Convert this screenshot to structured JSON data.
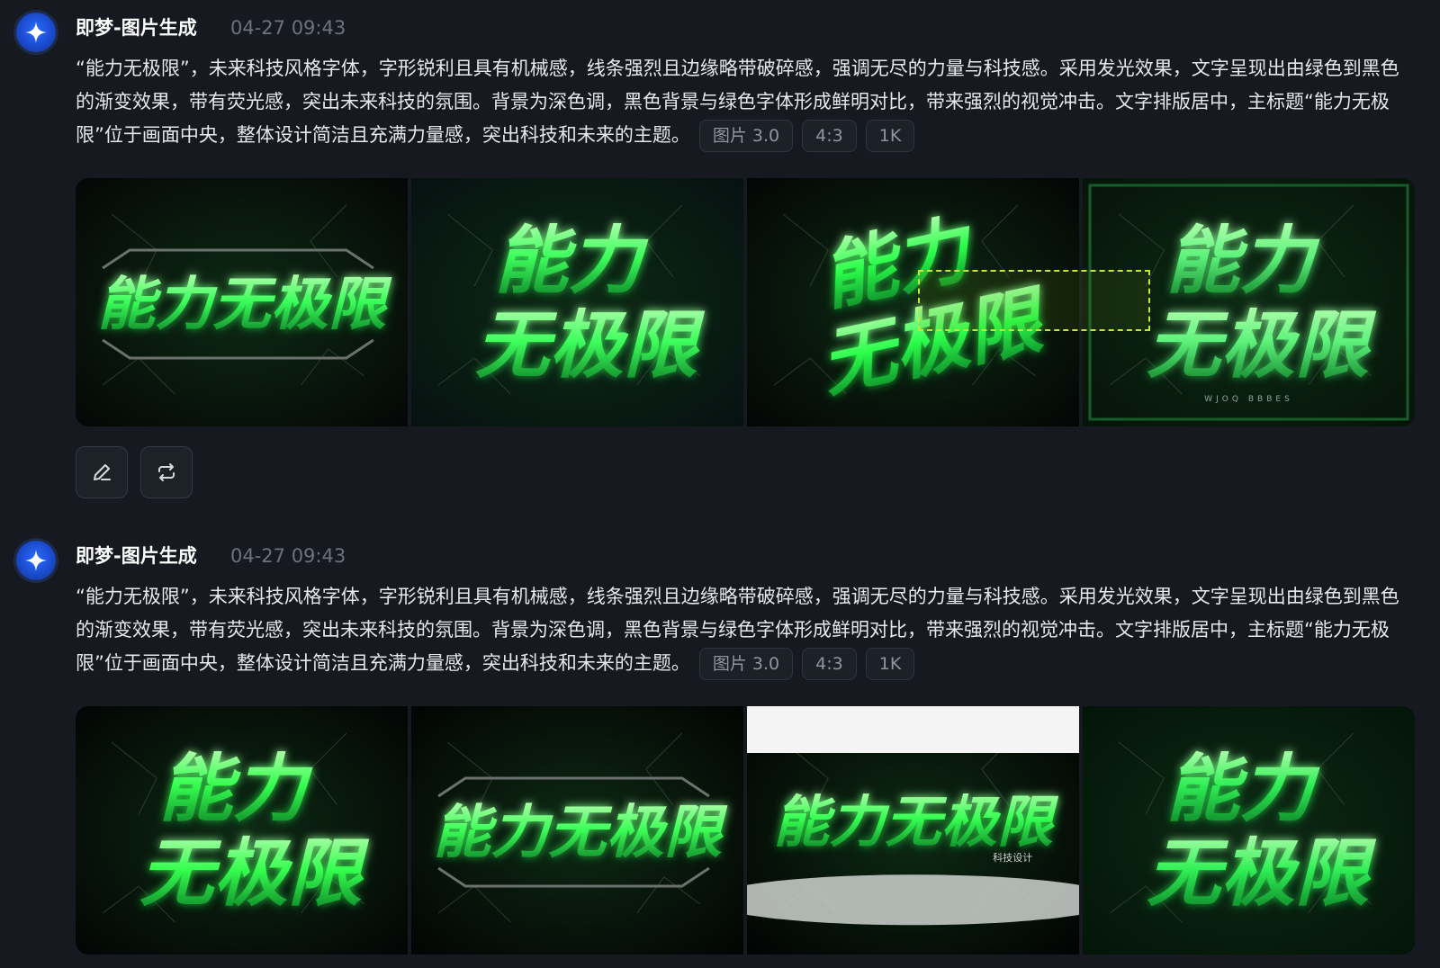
{
  "messages": [
    {
      "sender": "即梦-图片生成",
      "time": "04-27  09:43",
      "prompt": "“能力无极限”，未来科技风格字体，字形锐利且具有机械感，线条强烈且边缘略带破碎感，强调无尽的力量与科技感。采用发光效果，文字呈现出由绿色到黑色的渐变效果，带有荧光感，突出未来科技的氛围。背景为深色调，黑色背景与绿色字体形成鲜明对比，带来强烈的视觉冲击。文字排版居中，主标题“能力无极限”位于画面中央，整体设计简洁且充满力量感，突出科技和未来的主题。",
      "tags": [
        "图片 3.0",
        "4:3",
        "1K"
      ],
      "images": [
        {
          "text": "能力无极限",
          "layout": "single",
          "color": "#39ff5a",
          "bg": "#050706",
          "subtext": ""
        },
        {
          "text": "能力无极限",
          "layout": "double",
          "color": "#3dff5c",
          "bg": "#061211",
          "subtext": ""
        },
        {
          "text": "能力无极限",
          "layout": "double-tilt",
          "color": "#2cff4b",
          "bg": "#040605",
          "subtext": ""
        },
        {
          "text": "能力无极限",
          "layout": "double-outline",
          "color": "#5cf27a",
          "bg": "#061409",
          "subtext": "WJOQ  BBBES"
        }
      ],
      "actions": {
        "edit_icon": "pencil-icon",
        "regenerate_icon": "repeat-icon"
      }
    },
    {
      "sender": "即梦-图片生成",
      "time": "04-27  09:43",
      "prompt": "“能力无极限”，未来科技风格字体，字形锐利且具有机械感，线条强烈且边缘略带破碎感，强调无尽的力量与科技感。采用发光效果，文字呈现出由绿色到黑色的渐变效果，带有荧光感，突出未来科技的氛围。背景为深色调，黑色背景与绿色字体形成鲜明对比，带来强烈的视觉冲击。文字排版居中，主标题“能力无极限”位于画面中央，整体设计简洁且充满力量感，突出科技和未来的主题。",
      "tags": [
        "图片 3.0",
        "4:3",
        "1K"
      ],
      "images": [
        {
          "text": "能力无极限",
          "layout": "double",
          "color": "#35ff4f",
          "bg": "#030504",
          "subtext": ""
        },
        {
          "text": "能力无极限",
          "layout": "single",
          "color": "#3cff58",
          "bg": "#030403",
          "subtext": ""
        },
        {
          "text": "能力无极限",
          "layout": "single-white-band",
          "color": "#36ff52",
          "bg": "#020302",
          "subtext": "科技设计"
        },
        {
          "text": "能力无极限",
          "layout": "double",
          "color": "#30ef55",
          "bg": "#041409",
          "subtext": ""
        }
      ]
    }
  ],
  "overlay": {
    "selection": "dashed-rectangle",
    "color": "#c7e63a"
  }
}
